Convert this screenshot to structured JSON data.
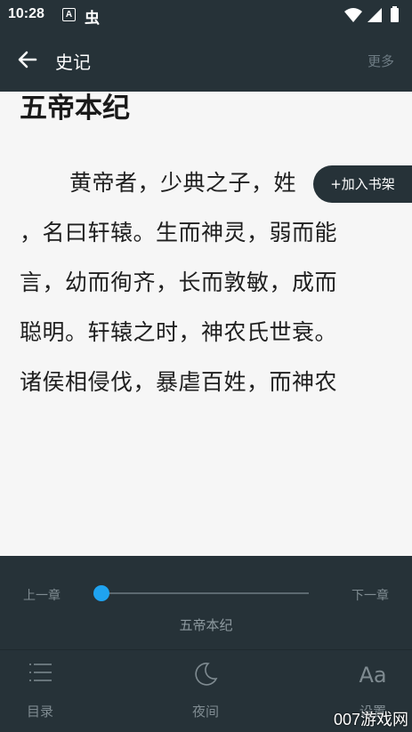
{
  "status_bar": {
    "time": "10:28",
    "notif_icon_a": "A",
    "notif_icon_bug": "虫"
  },
  "toolbar": {
    "back_icon": "arrow-back-icon",
    "title": "史记",
    "more_label": "更多"
  },
  "reader": {
    "chapter_title": "五帝本纪",
    "lines": [
      "黄帝者，少典之子，姓",
      "，名曰轩辕。生而神灵，弱而能",
      "言，幼而徇齐，长而敦敏，成而",
      "聪明。轩辕之时，神农氏世衰。",
      "诸侯相侵伐，暴虐百姓，而神农"
    ],
    "add_to_shelf_label": "+加入书架"
  },
  "bottom_panel": {
    "prev_chapter_label": "上一章",
    "next_chapter_label": "下一章",
    "current_chapter": "五帝本纪",
    "progress_fraction": 0.0,
    "nav": [
      {
        "label": "目录",
        "icon": "list-icon"
      },
      {
        "label": "夜间",
        "icon": "moon-icon"
      },
      {
        "label": "设置",
        "icon": "font-aa-icon",
        "glyph": "Aa"
      }
    ]
  },
  "watermark": "007游戏网",
  "colors": {
    "bar_bg": "#263238",
    "page_bg": "#f6f6f6",
    "accent": "#1fa3f0"
  }
}
